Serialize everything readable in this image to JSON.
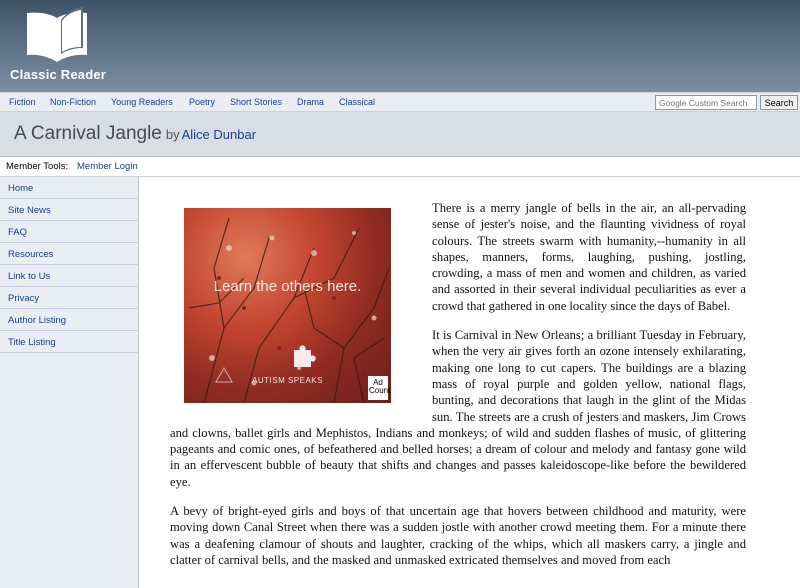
{
  "site": {
    "name": "Classic Reader",
    "logo_icon": "open-book-icon"
  },
  "nav": {
    "items": [
      "Fiction",
      "Non-Fiction",
      "Young Readers",
      "Poetry",
      "Short Stories",
      "Drama",
      "Classical"
    ]
  },
  "search": {
    "placeholder": "Google Custom Search",
    "button_label": "Search"
  },
  "book": {
    "title": "A Carnival Jangle",
    "by": "by",
    "author": "Alice Dunbar"
  },
  "member": {
    "label": "Member Tools:",
    "login": "Member Login"
  },
  "sidebar": {
    "items": [
      "Home",
      "Site News",
      "FAQ",
      "Resources",
      "Link to Us",
      "Privacy",
      "Author Listing",
      "Title Listing"
    ]
  },
  "ad": {
    "text": "Learn the others here.",
    "brand": "AUTISM SPEAKS",
    "badge": "Ad Council"
  },
  "article": {
    "paragraphs": [
      "There is a merry jangle of bells in the air, an all-pervading sense of jester's noise, and the flaunting vividness of royal colours. The streets swarm with humanity,--humanity in all shapes, manners, forms, laughing, pushing, jostling, crowding, a mass of men and women and children, as varied and assorted in their several individual peculiarities as ever a crowd that gathered in one locality since the days of Babel.",
      "It is Carnival in New Orleans; a brilliant Tuesday in February, when the very air gives forth an ozone intensely exhilarating, making one long to cut capers. The buildings are a blazing mass of royal purple and golden yellow, national flags, bunting, and decorations that laugh in the glint of the Midas sun. The streets are a crush of jesters and maskers, Jim Crows and clowns, ballet girls and Mephistos, Indians and monkeys; of wild and sudden flashes of music, of glittering pageants and comic ones, of befeathered and belled horses; a dream of colour and melody and fantasy gone wild in an effervescent bubble of beauty that shifts and changes and passes kaleidoscope-like before the bewildered eye.",
      "A bevy of bright-eyed girls and boys of that uncertain age that hovers between childhood and maturity, were moving down Canal Street when there was a sudden jostle with another crowd meeting them. For a minute there was a deafening clamour of shouts and laughter, cracking of the whips, which all maskers carry, a jingle and clatter of carnival bells, and the masked and unmasked extricated themselves and moved from each"
    ]
  },
  "colors": {
    "header_top": "#3f5266",
    "link": "#1b3f86",
    "sidebar_bg": "#e9eef5",
    "ad_red": "#c2452f"
  }
}
